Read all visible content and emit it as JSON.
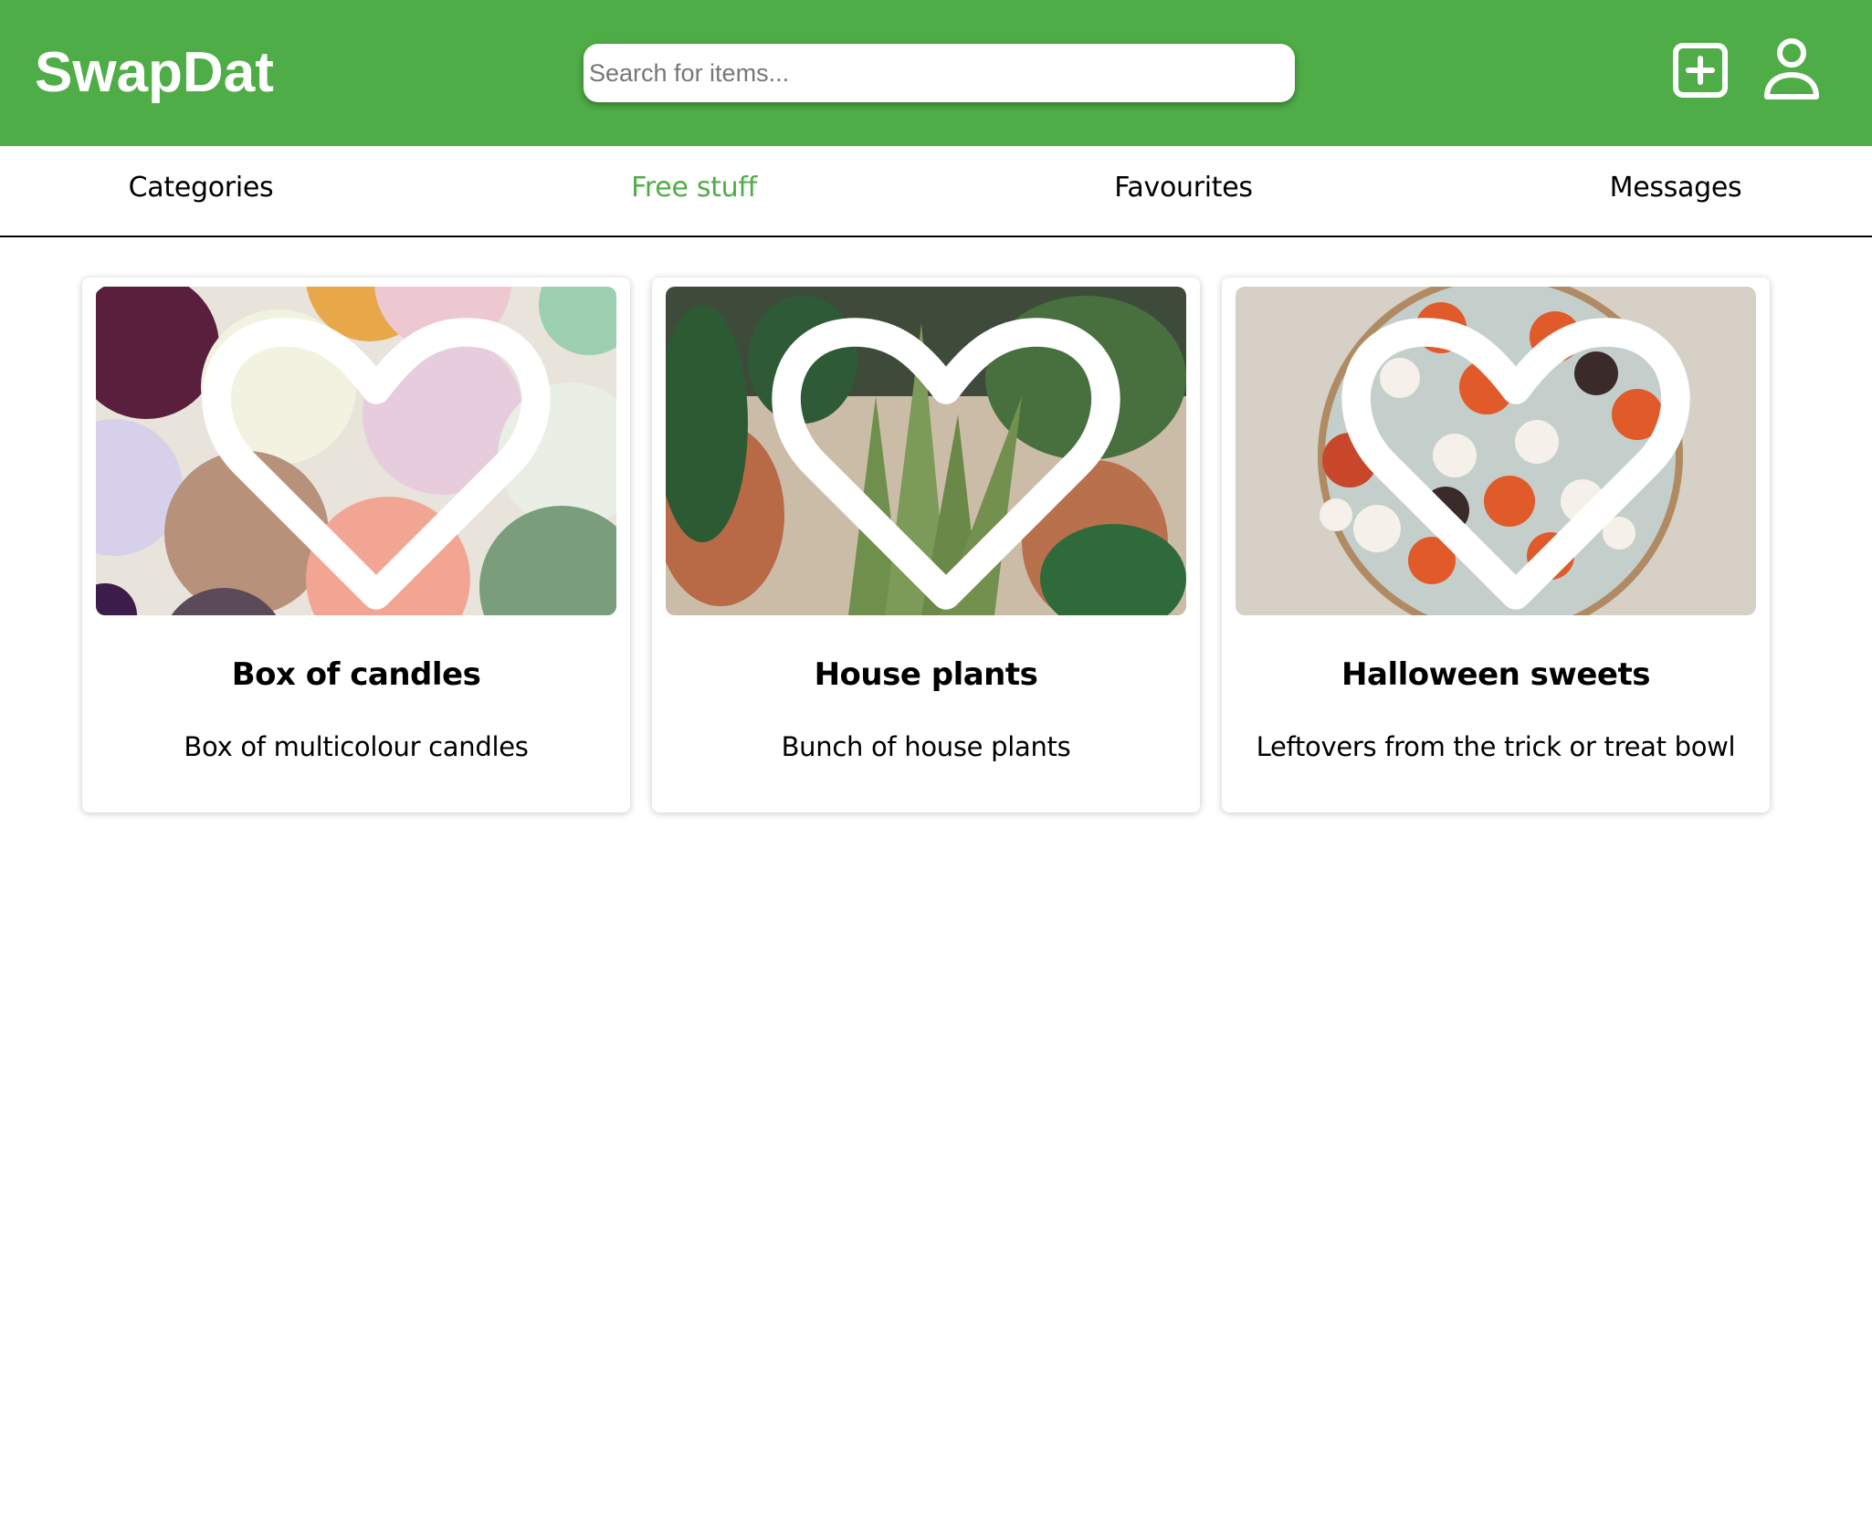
{
  "header": {
    "logo": "SwapDat",
    "search_placeholder": "Search for items...",
    "search_value": "",
    "add_icon": "plus-square-icon",
    "user_icon": "user-icon",
    "brand_color": "#4fad47"
  },
  "nav": {
    "items": [
      {
        "label": "Categories",
        "active": false
      },
      {
        "label": "Free stuff",
        "active": true
      },
      {
        "label": "Favourites",
        "active": false
      },
      {
        "label": "Messages",
        "active": false
      }
    ]
  },
  "items": [
    {
      "title": "Box of candles",
      "description": "Box of multicolour candles",
      "image": "candles-photo",
      "favourite": false
    },
    {
      "title": "House plants",
      "description": "Bunch of house plants",
      "image": "plants-photo",
      "favourite": false
    },
    {
      "title": "Halloween sweets",
      "description": "Leftovers from the trick or treat bowl",
      "image": "halloween-sweets-photo",
      "favourite": false
    }
  ]
}
